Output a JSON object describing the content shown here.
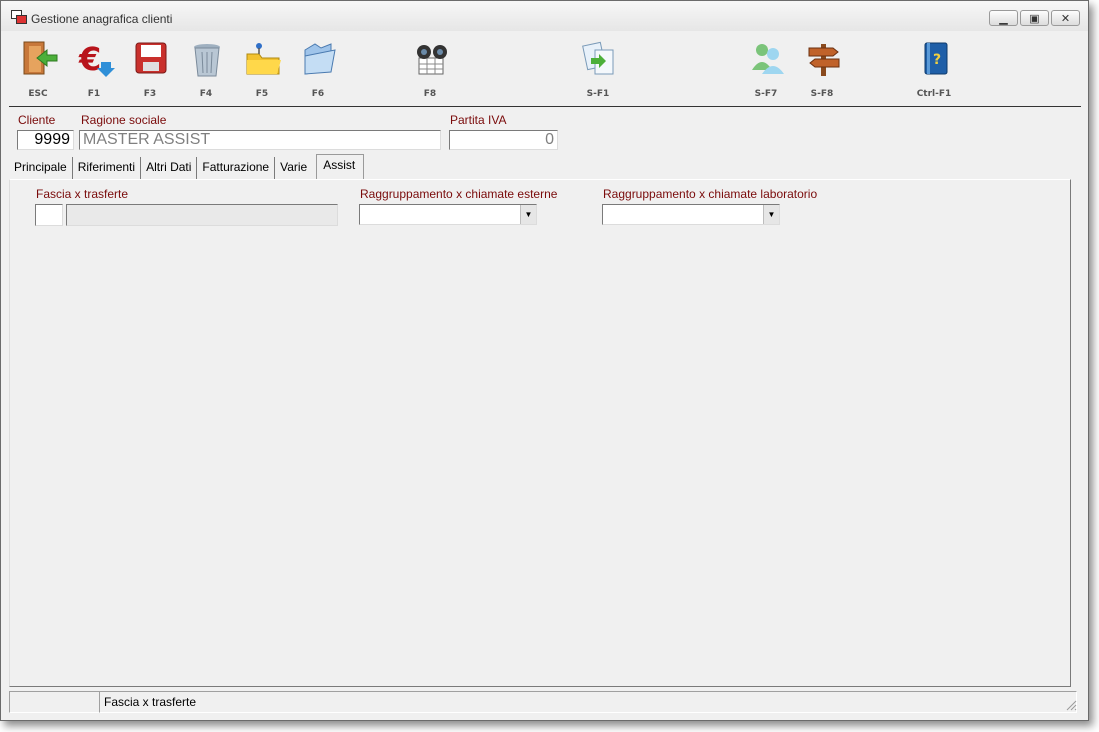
{
  "window": {
    "title": "Gestione anagrafica clienti"
  },
  "toolbar": {
    "buttons": [
      {
        "label": "ESC",
        "icon": "exit-door-icon"
      },
      {
        "label": "F1",
        "icon": "euro-icon"
      },
      {
        "label": "F3",
        "icon": "save-disk-icon"
      },
      {
        "label": "F4",
        "icon": "trash-icon"
      },
      {
        "label": "F5",
        "icon": "folder-pin-icon"
      },
      {
        "label": "F6",
        "icon": "open-folder-icon"
      },
      {
        "label": "F8",
        "icon": "binoculars-icon"
      },
      {
        "label": "S-F1",
        "icon": "copy-documents-icon"
      },
      {
        "label": "S-F7",
        "icon": "users-icon"
      },
      {
        "label": "S-F8",
        "icon": "signpost-icon"
      },
      {
        "label": "Ctrl-F1",
        "icon": "help-book-icon"
      }
    ]
  },
  "header": {
    "cliente_label": "Cliente",
    "cliente_value": "9999",
    "ragione_label": "Ragione sociale",
    "ragione_value": "MASTER ASSIST",
    "piva_label": "Partita IVA",
    "piva_value": "0"
  },
  "tabs": [
    {
      "label": "Principale"
    },
    {
      "label": "Riferimenti"
    },
    {
      "label": "Altri Dati"
    },
    {
      "label": "Fatturazione"
    },
    {
      "label": "Varie"
    },
    {
      "label": "Assist",
      "active": true
    }
  ],
  "assist": {
    "fascia_label": "Fascia x trasferte",
    "fascia_code": "",
    "fascia_desc": "",
    "esterne_label": "Raggruppamento x chiamate esterne",
    "esterne_value": "",
    "laboratorio_label": "Raggruppamento x chiamate laboratorio",
    "laboratorio_value": ""
  },
  "statusbar": {
    "pane1": "",
    "pane2": "Fascia x trasferte"
  },
  "colors": {
    "label_red": "#7a0b0b",
    "window_bg": "#f0f0f0"
  }
}
